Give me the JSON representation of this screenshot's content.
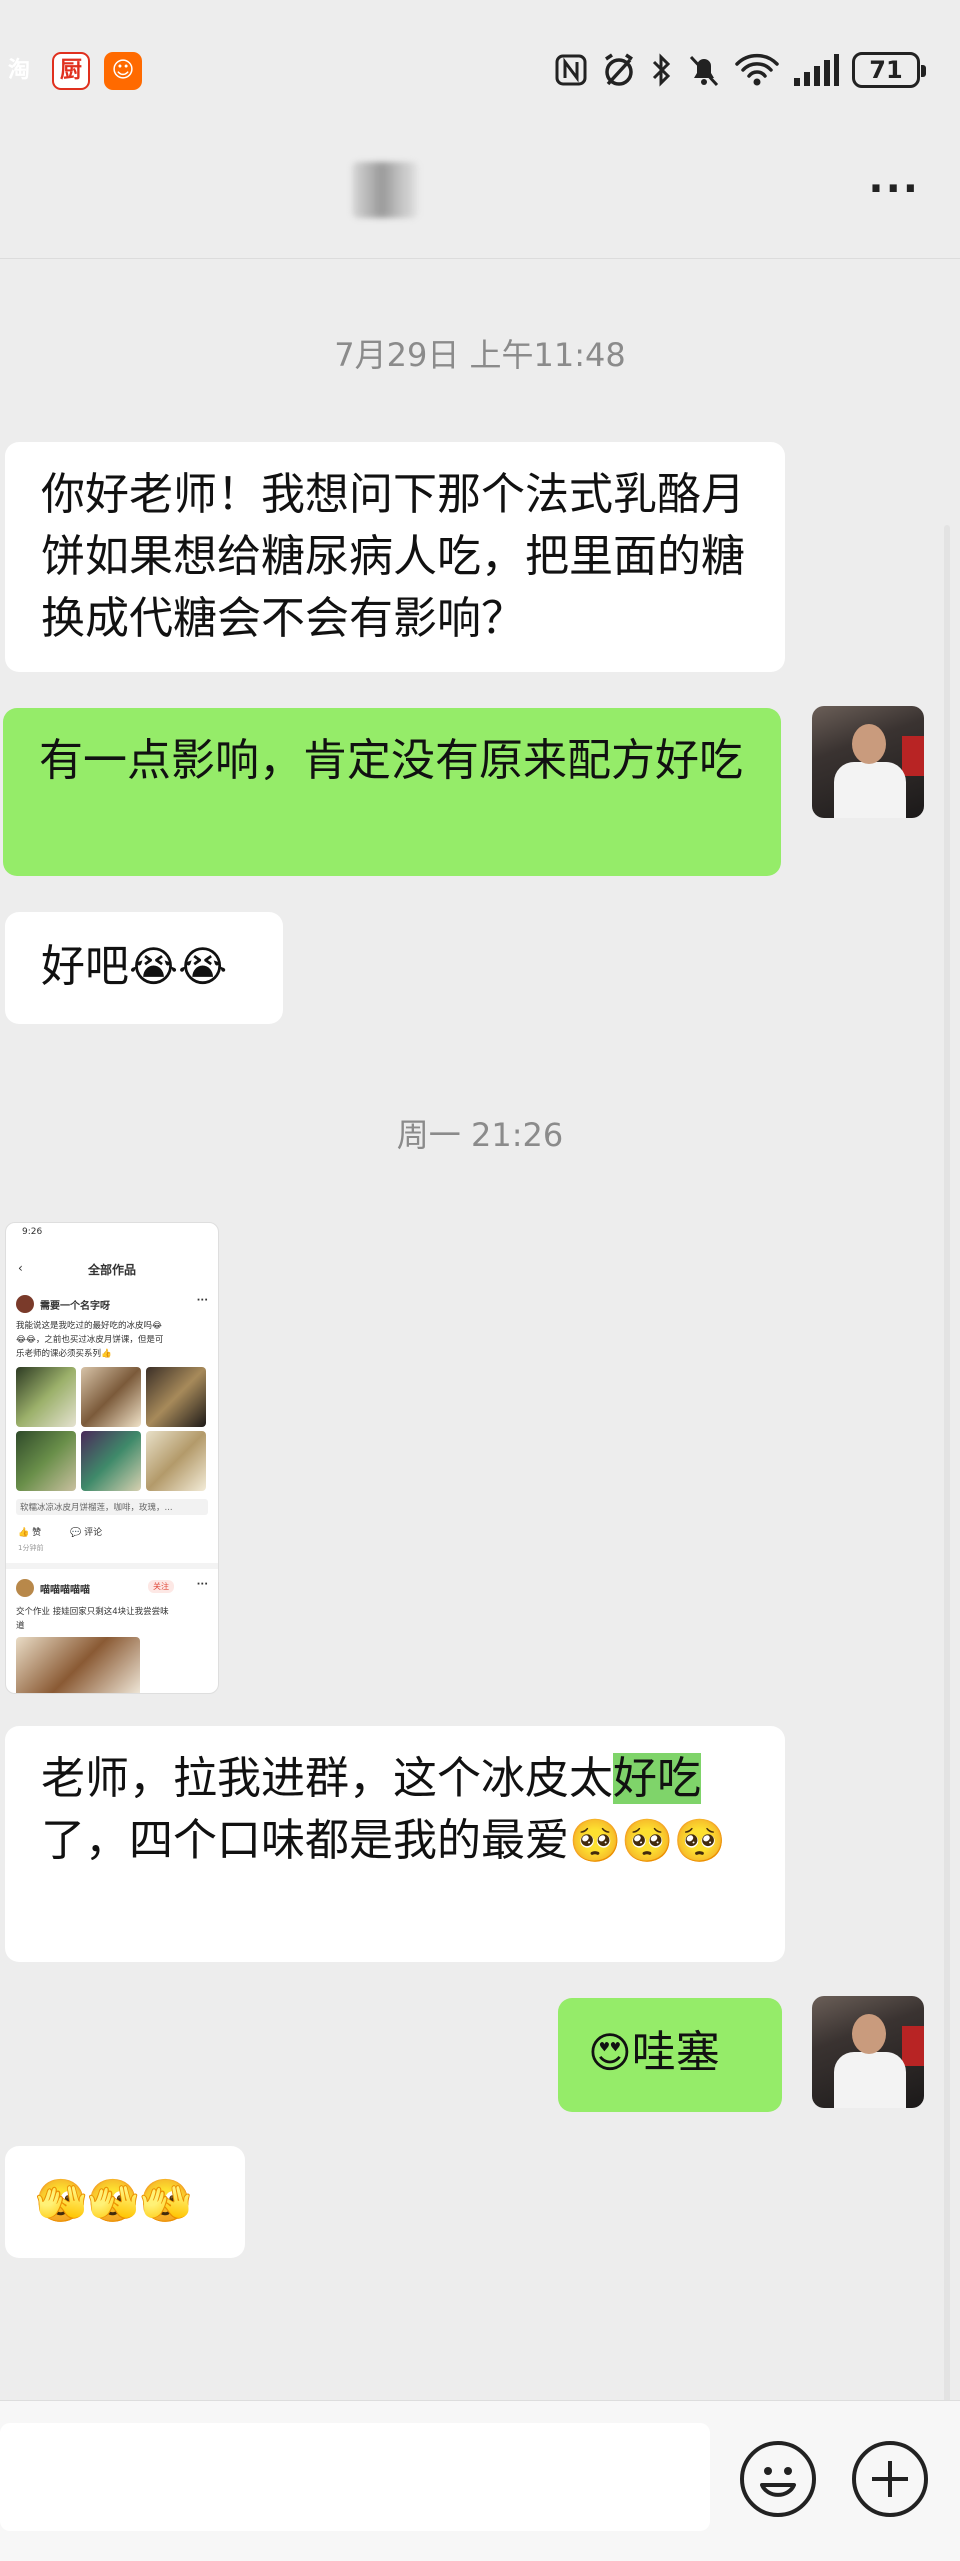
{
  "status_bar": {
    "apps": [
      {
        "glyph": "淘",
        "color": "#ff5500",
        "icon": "taobao-app-icon"
      },
      {
        "glyph": "厨",
        "color": "#e0301e",
        "icon": "kitchen-app-icon"
      },
      {
        "glyph": "☺",
        "color": "#ff6a00",
        "icon": "orange-app-icon"
      }
    ],
    "battery": "71"
  },
  "header": {
    "more_label": "···"
  },
  "messages": {
    "ts1": "7月29日 上午11:48",
    "m1": "你好老师！我想问下那个法式乳酪月饼如果想给糖尿病人吃，把里面的糖换成代糖会不会有影响？",
    "m2": "有一点影响，肯定没有原来配方好吃",
    "m3_text": "好吧",
    "m3_emoji": "😭😭",
    "ts2": "周一 21:26",
    "m5_a": "老师，拉我进群，这个冰皮太",
    "m5_hl": "好吃",
    "m5_b": "了，四个口味都是我的最爱",
    "m5_emoji1": "🥺🥺",
    "m5_emoji2": "🥺",
    "m6_emoji": "😍",
    "m6_text": "哇塞",
    "m7_emoji": "🫣🫣🫣"
  },
  "shared_image": {
    "time": "9:26",
    "title": "全部作品",
    "author": "需要一个名字呀",
    "post_line1": "我能说这是我吃过的最好吃的冰皮吗😂",
    "post_line2": "😂😂，之前也买过冰皮月饼课，但是可",
    "post_line3": "乐老师的课必须买系列👍",
    "caption": "软糯冰凉冰皮月饼榴莲，咖啡，玫瑰，...",
    "like": "赞",
    "comment": "评论",
    "ago": "1分钟前",
    "author2": "喵喵喵喵喵",
    "follow": "关注",
    "post2_line1": "交个作业 接娃回家只剩这4块让我尝尝味",
    "post2_line2": "道"
  },
  "colors": {
    "background": "#ededed",
    "incoming_bubble": "#ffffff",
    "outgoing_bubble": "#95ec69",
    "highlight": "#7fd46a"
  }
}
